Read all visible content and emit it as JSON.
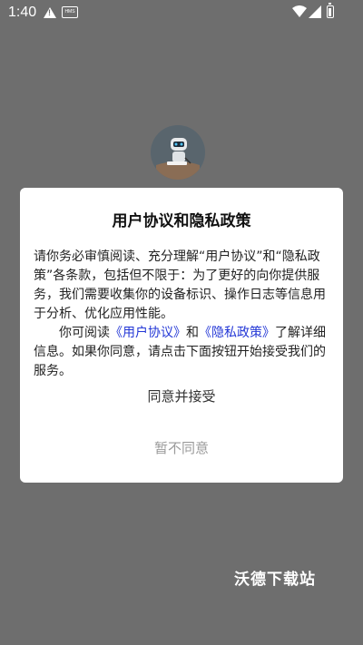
{
  "status_bar": {
    "time": "1:40",
    "hms_badge": "HMS"
  },
  "dialog": {
    "title": "用户协议和隐私政策",
    "body_para1": "请你务必审慎阅读、充分理解“用户协议”和“隐私政策”各条款，包括但不限于：为了更好的向你提供服务，我们需要收集你的设备标识、操作日志等信息用于分析、优化应用性能。",
    "body_para2_prefix": "你可阅读",
    "user_agreement_link": "《用户协议》",
    "and_text": "和",
    "privacy_policy_link": "《隐私政策》",
    "body_para2_suffix": "了解详细信息。如果你同意，请点击下面按钮开始接受我们的服务。",
    "agree_label": "同意并接受",
    "disagree_label": "暂不同意"
  },
  "watermark": "沃德下载站",
  "colors": {
    "overlay": "#6e6e6e",
    "dialog_bg": "#ffffff",
    "link": "#2337d6",
    "disabled_text": "#9a9a9a"
  }
}
